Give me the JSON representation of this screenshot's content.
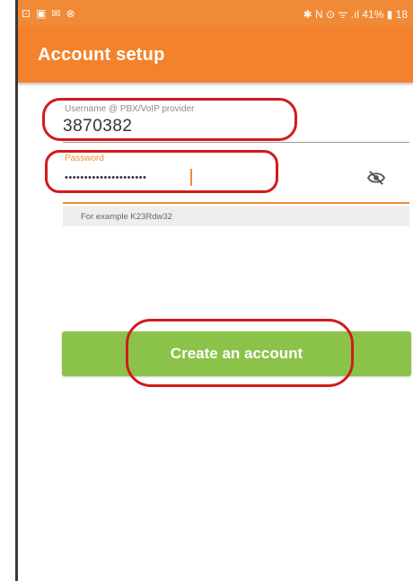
{
  "status_bar": {
    "left_icons": [
      "⊡",
      "▣",
      "✉",
      "⊗"
    ],
    "right_text": "✱ N ⊙ ᯤ .ıl 41% ▮ 18"
  },
  "app_bar": {
    "title": "Account setup"
  },
  "form": {
    "username": {
      "label": "Username @ PBX/VoIP provider",
      "value": "3870382"
    },
    "password": {
      "label": "Password",
      "value_masked": "•••••••••••••••••••••"
    },
    "hint": "For example K23Rdw32"
  },
  "create_button": {
    "label": "Create an account"
  },
  "colors": {
    "accent": "#f4822c",
    "button": "#8bc34a",
    "annotation": "#d11b1b"
  }
}
